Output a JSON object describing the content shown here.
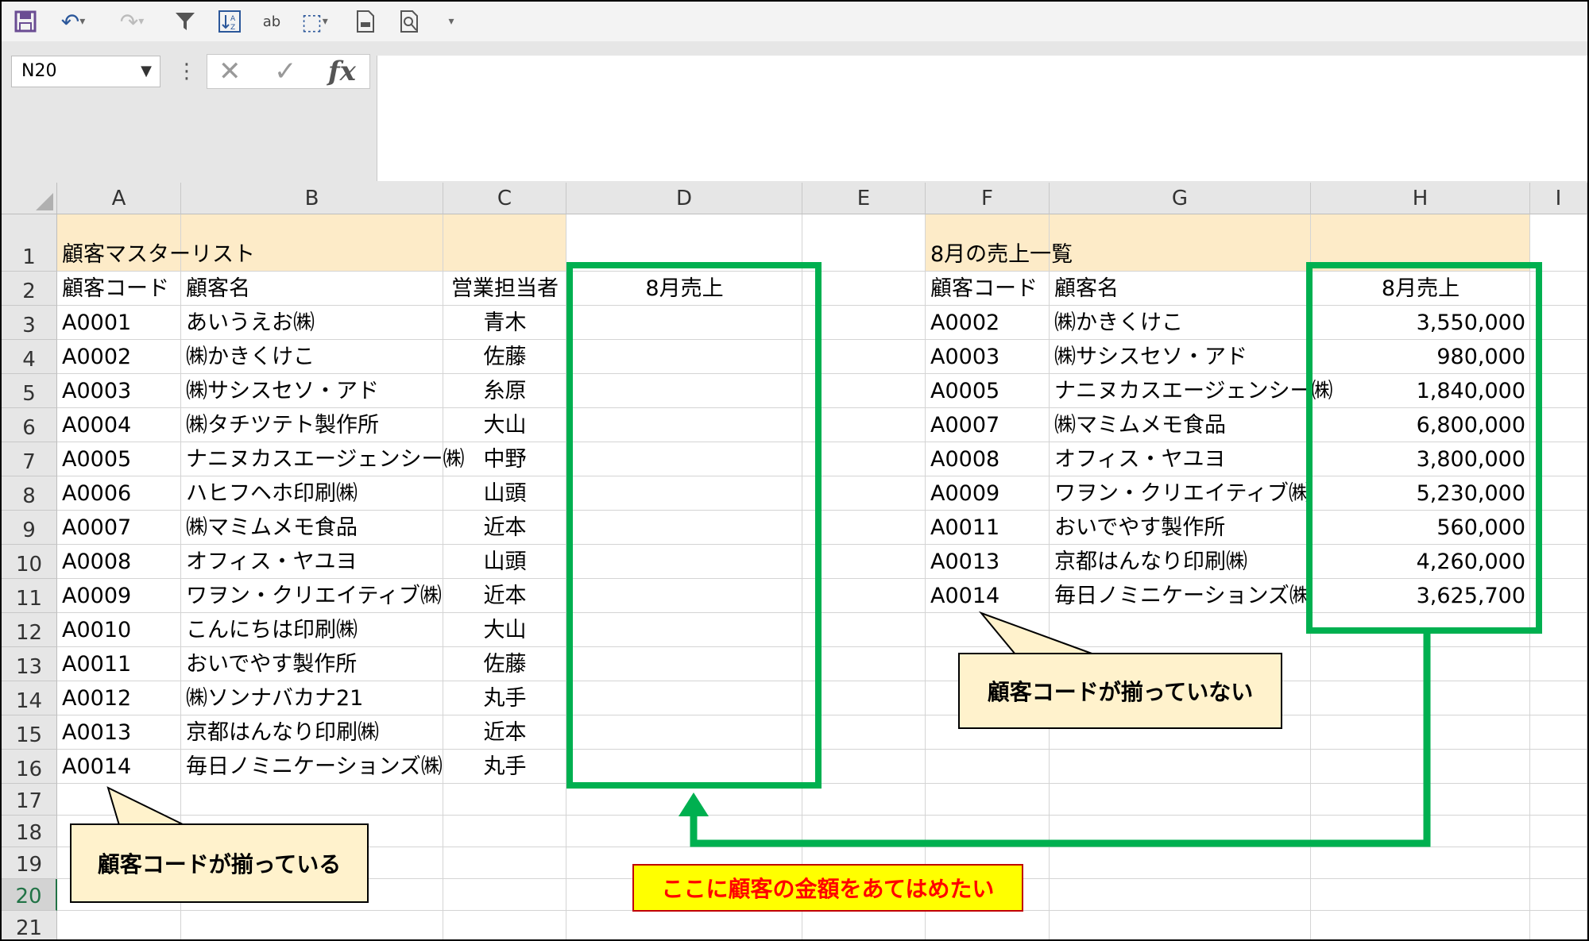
{
  "toolbar": {
    "icons": [
      "save-icon",
      "undo-icon",
      "redo-icon",
      "filter-icon",
      "sort-icon",
      "spelling-icon",
      "format-painter-icon",
      "print-preview-icon",
      "zoom-icon",
      "customize-icon"
    ]
  },
  "formula_bar": {
    "name_box": "N20",
    "cancel_glyph": "✕",
    "enter_glyph": "✓",
    "fx_label": "fx",
    "formula": ""
  },
  "columns": [
    "A",
    "B",
    "C",
    "D",
    "E",
    "F",
    "G",
    "H",
    "I"
  ],
  "rows": [
    "1",
    "2",
    "3",
    "4",
    "5",
    "6",
    "7",
    "8",
    "9",
    "10",
    "11",
    "12",
    "13",
    "14",
    "15",
    "16",
    "17",
    "18",
    "19",
    "20",
    "21"
  ],
  "selected_row": "20",
  "master": {
    "title": "顧客マスターリスト",
    "headers": [
      "顧客コード",
      "顧客名",
      "営業担当者",
      "8月売上"
    ],
    "rows": [
      [
        "A0001",
        "あいうえお㈱",
        "青木"
      ],
      [
        "A0002",
        "㈱かきくけこ",
        "佐藤"
      ],
      [
        "A0003",
        "㈱サシスセソ・アド",
        "糸原"
      ],
      [
        "A0004",
        "㈱タチツテト製作所",
        "大山"
      ],
      [
        "A0005",
        "ナニヌカスエージェンシー㈱",
        "中野"
      ],
      [
        "A0006",
        "ハヒフヘホ印刷㈱",
        "山頭"
      ],
      [
        "A0007",
        "㈱マミムメモ食品",
        "近本"
      ],
      [
        "A0008",
        "オフィス・ヤユヨ",
        "山頭"
      ],
      [
        "A0009",
        "ワヲン・クリエイティブ㈱",
        "近本"
      ],
      [
        "A0010",
        "こんにちは印刷㈱",
        "大山"
      ],
      [
        "A0011",
        "おいでやす製作所",
        "佐藤"
      ],
      [
        "A0012",
        "㈱ソンナバカナ21",
        "丸手"
      ],
      [
        "A0013",
        "京都はんなり印刷㈱",
        "近本"
      ],
      [
        "A0014",
        "毎日ノミニケーションズ㈱",
        "丸手"
      ]
    ]
  },
  "sales": {
    "title": "8月の売上一覧",
    "headers": [
      "顧客コード",
      "顧客名",
      "8月売上"
    ],
    "rows": [
      [
        "A0002",
        "㈱かきくけこ",
        "3,550,000"
      ],
      [
        "A0003",
        "㈱サシスセソ・アド",
        "980,000"
      ],
      [
        "A0005",
        "ナニヌカスエージェンシー㈱",
        "1,840,000"
      ],
      [
        "A0007",
        "㈱マミムメモ食品",
        "6,800,000"
      ],
      [
        "A0008",
        "オフィス・ヤユヨ",
        "3,800,000"
      ],
      [
        "A0009",
        "ワヲン・クリエイティブ㈱",
        "5,230,000"
      ],
      [
        "A0011",
        "おいでやす製作所",
        "560,000"
      ],
      [
        "A0013",
        "京都はんなり印刷㈱",
        "4,260,000"
      ],
      [
        "A0014",
        "毎日ノミニケーションズ㈱",
        "3,625,700"
      ]
    ]
  },
  "annotations": {
    "aligned": "顧客コードが揃っている",
    "not_aligned": "顧客コードが揃っていない",
    "target": "ここに顧客の金額をあてはめたい"
  },
  "colors": {
    "highlight": "#00b050",
    "title_fill": "#fdebc8",
    "callout_fill": "#fff2cc",
    "target_text": "#ff0000",
    "target_fill": "#ffff00"
  }
}
